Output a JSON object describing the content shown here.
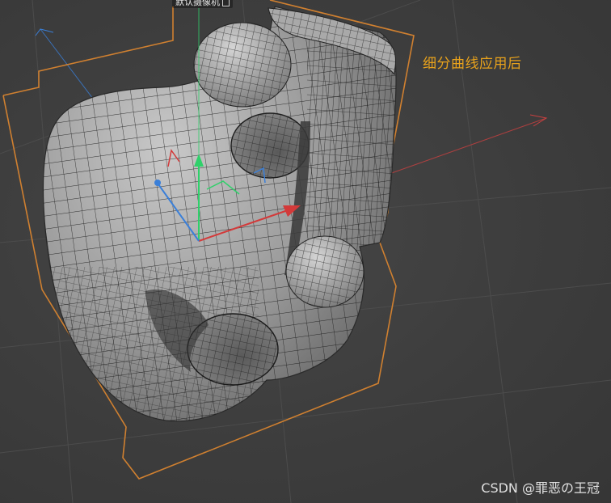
{
  "viewport": {
    "camera_label": "默认摄像机",
    "camera_icon": "camera-icon"
  },
  "annotation": {
    "text": "细分曲线应用后",
    "color": "#e8a21c"
  },
  "watermark": {
    "text": "CSDN @罪恶の王冠"
  },
  "colors": {
    "background": "#3f3f3f",
    "bounding_box": "#d08030",
    "axis_x": "#d33a3a",
    "axis_y": "#2fd06a",
    "axis_z": "#3a7fd8",
    "mesh_fill": "#8c8c8c",
    "wire": "#1a1a1a"
  }
}
